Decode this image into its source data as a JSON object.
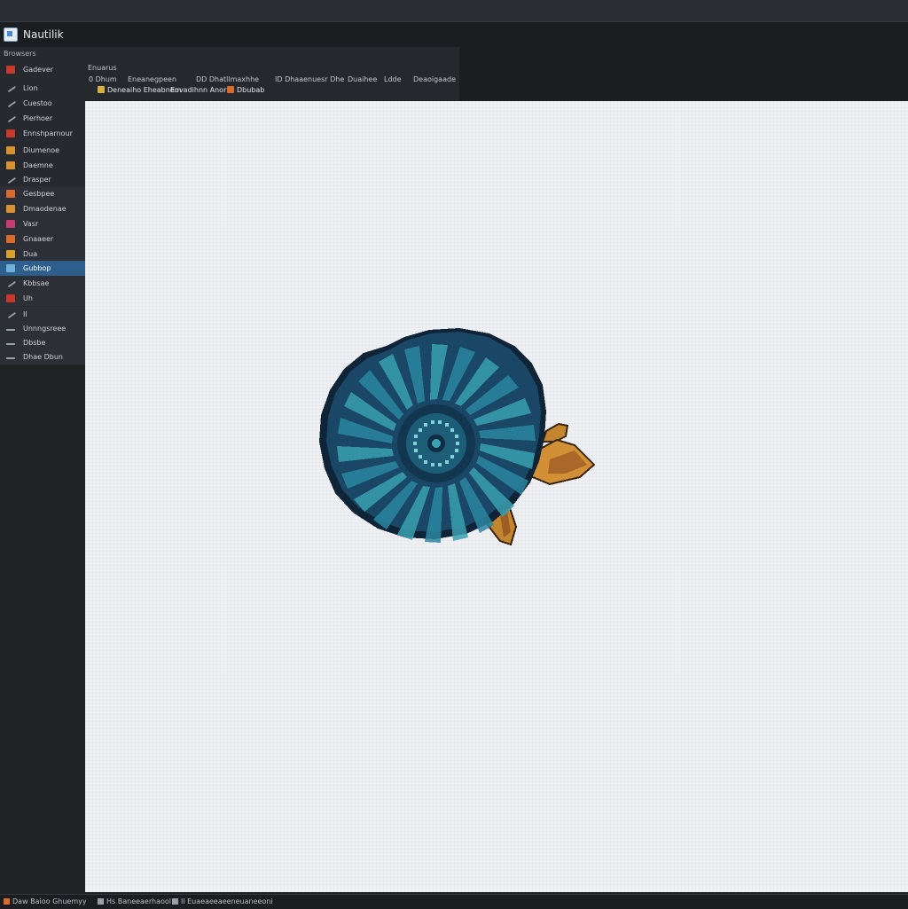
{
  "window": {
    "title": "Nautilik"
  },
  "sidebar": {
    "header": "Browsers",
    "items": [
      {
        "label": "Gadever",
        "icon": "red-app-icon",
        "color": "#c9372c"
      },
      {
        "label": "Lion",
        "icon": "pencil-icon",
        "color": "#9aa0a8"
      },
      {
        "label": "Cuestoo",
        "icon": "search-icon",
        "color": "#9aa0a8"
      },
      {
        "label": "Pierhoer",
        "icon": "grid-icon",
        "color": "#9aa0a8"
      },
      {
        "label": "Ennshparnour",
        "icon": "red-app-icon",
        "color": "#c9372c"
      },
      {
        "label": "Diumenoe",
        "icon": "folder-icon",
        "color": "#d7912e"
      },
      {
        "label": "Daemne",
        "icon": "folder-icon",
        "color": "#d7912e"
      },
      {
        "label": "Drasper",
        "icon": "pencil-icon",
        "color": "#9aa0a8"
      },
      {
        "label": "Gesbpee",
        "icon": "orange-app-icon",
        "color": "#d96a2b"
      },
      {
        "label": "Dmaodenae",
        "icon": "folder-icon",
        "color": "#d7912e"
      },
      {
        "label": "Vasr",
        "icon": "magenta-app-icon",
        "color": "#c93a6e"
      },
      {
        "label": "Gnaaeer",
        "icon": "orange-app-icon",
        "color": "#d96a2b"
      },
      {
        "label": "Dua",
        "icon": "yellow-app-icon",
        "color": "#d9a02b"
      },
      {
        "label": "Gubbop",
        "icon": "brush-icon",
        "color": "#6fb1d9",
        "selected": true
      },
      {
        "label": "Kbbsae",
        "icon": "pencil-icon",
        "color": "#9aa0a8"
      },
      {
        "label": "Uh",
        "icon": "red-app-icon",
        "color": "#c9372c"
      },
      {
        "label": "Il",
        "icon": "pencil-icon",
        "color": "#9aa0a8"
      },
      {
        "label": "Unnngsreee",
        "icon": "line-icon",
        "color": "#9aa0a8"
      },
      {
        "label": "Dbsbe",
        "icon": "line-icon",
        "color": "#9aa0a8"
      },
      {
        "label": "Dhae Dbun",
        "icon": "line-icon",
        "color": "#9aa0a8"
      }
    ]
  },
  "toolbar": {
    "row1": "Enuarus",
    "row2": [
      {
        "label": "0 Dhum"
      },
      {
        "label": "Eneanegpeen"
      },
      {
        "label": "DD Dhatllmaxhhe"
      },
      {
        "label": "ID Dhaaenuesr Dhe"
      },
      {
        "label": "Duaihee"
      },
      {
        "label": "Ldde"
      },
      {
        "label": "Deaoigaade"
      }
    ],
    "row3": [
      {
        "label": "Deneaiho Eheabnem",
        "icon": "folder-icon"
      },
      {
        "label": "Eovadihnn Anor",
        "icon": ""
      },
      {
        "label": "Dbubab",
        "icon": "orange-app-icon"
      }
    ]
  },
  "statusbar": {
    "items": [
      {
        "label": "Daw Baioo Ghuemyy"
      },
      {
        "label": "Hs Baneeaerhaool"
      },
      {
        "label": "Il Euaeaeeaeeneuaneeoni"
      }
    ]
  },
  "canvas": {
    "content": "nautilus-shell-sprite"
  },
  "colors": {
    "accent": "#2e5f8c",
    "shell_dark": "#173a55",
    "shell_mid": "#1f6a86",
    "shell_light": "#6fc2c9",
    "fin": "#c4852f"
  }
}
